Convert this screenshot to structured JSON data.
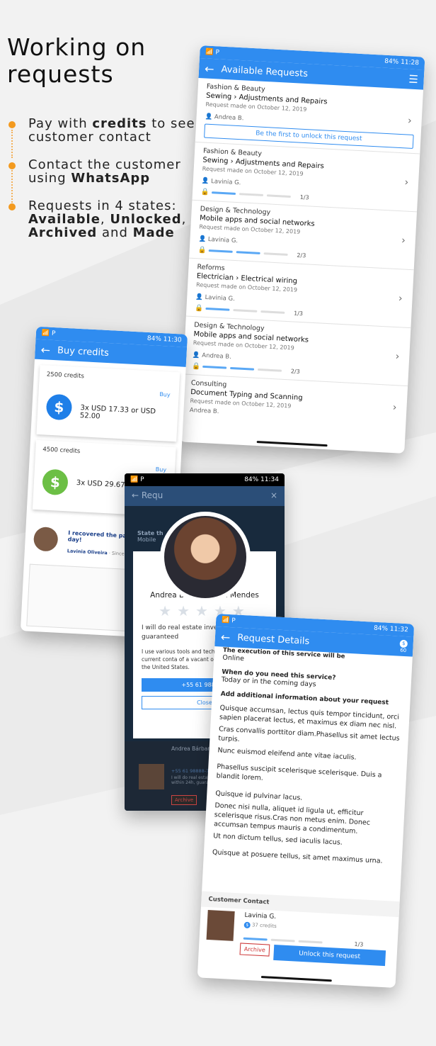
{
  "hero": {
    "title_line1": "Working on",
    "title_line2": "requests"
  },
  "bullets": [
    {
      "pre": "Pay with ",
      "b1": "credits",
      "post": " to see customer contact"
    },
    {
      "pre": "Contact the customer using ",
      "b1": "WhatsApp",
      "post": ""
    },
    {
      "pre": "Requests in 4 states: ",
      "b1": "Available",
      "mid1": ", ",
      "b2": "Unlocked",
      "mid2": ", ",
      "b3": "Archived",
      "mid3": " and ",
      "b4": "Made"
    }
  ],
  "colors": {
    "accent": "#2f8cf0",
    "bullet": "#f39a1f"
  },
  "available": {
    "status_time": "84% 11:28",
    "title": "Available Requests",
    "requests": [
      {
        "cat": "Fashion & Beauty",
        "sub": "Sewing › Adjustments and Repairs",
        "meta": "Request made on October 12, 2019",
        "user": "Andrea B.",
        "button": "Be the first to unlock this request"
      },
      {
        "cat": "Fashion & Beauty",
        "sub": "Sewing › Adjustments and Repairs",
        "meta": "Request made on October 12, 2019",
        "user": "Lavinia G.",
        "count": "1/3"
      },
      {
        "cat": "Design & Technology",
        "sub": "Mobile apps and social networks",
        "meta": "Request made on October 12, 2019",
        "user": "Lavinia G.",
        "count": "2/3"
      },
      {
        "cat": "Reforms",
        "sub": "Electrician › Electrical wiring",
        "meta": "Request made on October 12, 2019",
        "user": "Lavinia G.",
        "count": "1/3"
      },
      {
        "cat": "Design & Technology",
        "sub": "Mobile apps and social networks",
        "meta": "Request made on October 12, 2019",
        "user": "Andrea B.",
        "count": "2/3"
      },
      {
        "cat": "Consulting",
        "sub": "Document Typing and Scanning",
        "meta": "Request made on October 12, 2019",
        "user": "Andrea B."
      }
    ]
  },
  "buy": {
    "status_time": "84% 11:30",
    "title": "Buy credits",
    "packs": [
      {
        "label": "2500 credits",
        "buy": "Buy",
        "price": "3x USD 17.33 or USD 52.00",
        "color": "#1f7fe8"
      },
      {
        "label": "4500 credits",
        "buy": "Buy",
        "price": "3x USD 29.67 o",
        "color": "#6cbf45"
      }
    ],
    "testimonial_text": "I recovered the pac",
    "testimonial_text2": "day!",
    "testimonial_author": "Lavinia Oliveira",
    "testimonial_since": "· Since L"
  },
  "profile": {
    "status_time": "84% 11:34",
    "bg_title": "Requ",
    "bg_state": "State th",
    "bg_mobile": "Mobile",
    "bg_close": "×",
    "name": "Andrea Bárbara Vera Mendes",
    "headline": "I will do real estate investor within 24h, guaranteed",
    "body": "I use various tools and technic owner and their current conta of a vacant or abandoned pro in the United States.",
    "phone_btn": "+55 61 98888 7",
    "close_btn": "Close",
    "bg_name": "Andrea Bárbara V",
    "bg_phone": "+55 61 98888-7777",
    "bg_text": "I will do real estate within 24h, guarant",
    "bg_archive": "Archive"
  },
  "details": {
    "status_time": "84% 11:32",
    "title": "Request Details",
    "badge": "60",
    "partial": "The execution of this service will be",
    "online": "Online",
    "when_q": "When do you need this service?",
    "when_a": "Today or in the coming days",
    "add_info": "Add additional information about your request",
    "paragraphs": [
      "Quisque accumsan, lectus quis tempor tincidunt, orci sapien placerat lectus, et maximus ex diam nec nisl.",
      "Cras convallis porttitor diam.Phasellus sit amet lectus turpis.",
      "Nunc euismod eleifend ante vitae iaculis.",
      "Phasellus suscipit scelerisque scelerisque. Duis a blandit lorem.",
      "Quisque id pulvinar lacus.",
      "Donec nisi nulla, aliquet id ligula ut, efficitur scelerisque risus.Cras non metus enim. Donec accumsan tempus mauris a condimentum.",
      "Ut non dictum tellus, sed iaculis lacus.",
      "Quisque at posuere tellus, sit amet maximus urna."
    ],
    "contact_header": "Customer Contact",
    "contact_name": "Lavinia G.",
    "contact_credits": "37 credits",
    "count": "1/3",
    "archive": "Archive",
    "unlock": "Unlock this request"
  }
}
